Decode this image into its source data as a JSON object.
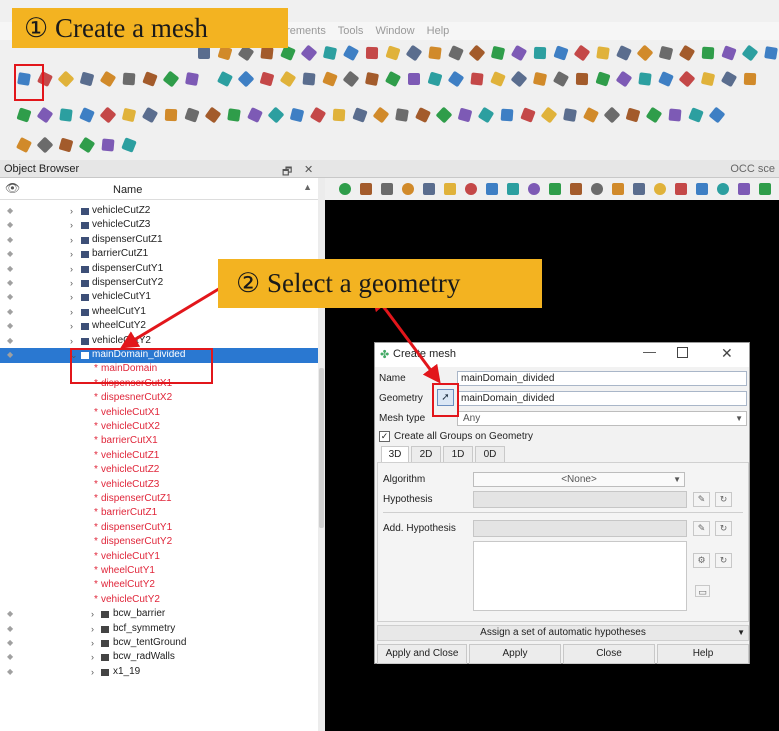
{
  "annotations": {
    "step1": "① Create a mesh",
    "step2": "② Select a geometry"
  },
  "menubar": {
    "items_visible": [
      "urements",
      "Tools",
      "Window",
      "Help"
    ]
  },
  "colors": {
    "banner": "#f3b321",
    "highlight_box": "#e2161b",
    "selection": "#2a78d1",
    "child_text": "#e0263a"
  },
  "object_browser": {
    "title": "Object Browser",
    "column_name": "Name",
    "items": [
      {
        "label": "vehicleCutZ2",
        "kind": "geom"
      },
      {
        "label": "vehicleCutZ3",
        "kind": "geom"
      },
      {
        "label": "dispenserCutZ1",
        "kind": "geom"
      },
      {
        "label": "barrierCutZ1",
        "kind": "geom"
      },
      {
        "label": "dispenserCutY1",
        "kind": "geom"
      },
      {
        "label": "dispenserCutY2",
        "kind": "geom"
      },
      {
        "label": "vehicleCutY1",
        "kind": "geom"
      },
      {
        "label": "wheelCutY1",
        "kind": "geom"
      },
      {
        "label": "wheelCutY2",
        "kind": "geom"
      },
      {
        "label": "vehicleCutY2",
        "kind": "geom"
      },
      {
        "label": "mainDomain_divided",
        "kind": "selected"
      },
      {
        "label": "mainDomain",
        "kind": "child"
      },
      {
        "label": "dispenserCutX1",
        "kind": "child"
      },
      {
        "label": "dispesnerCutX2",
        "kind": "child"
      },
      {
        "label": "vehicleCutX1",
        "kind": "child"
      },
      {
        "label": "vehicleCutX2",
        "kind": "child"
      },
      {
        "label": "barrierCutX1",
        "kind": "child"
      },
      {
        "label": "vehicleCutZ1",
        "kind": "child"
      },
      {
        "label": "vehicleCutZ2",
        "kind": "child"
      },
      {
        "label": "vehicleCutZ3",
        "kind": "child"
      },
      {
        "label": "dispenserCutZ1",
        "kind": "child"
      },
      {
        "label": "barrierCutZ1",
        "kind": "child"
      },
      {
        "label": "dispenserCutY1",
        "kind": "child"
      },
      {
        "label": "dispenserCutY2",
        "kind": "child"
      },
      {
        "label": "vehicleCutY1",
        "kind": "child"
      },
      {
        "label": "wheelCutY1",
        "kind": "child"
      },
      {
        "label": "wheelCutY2",
        "kind": "child"
      },
      {
        "label": "vehicleCutY2",
        "kind": "child"
      },
      {
        "label": "bcw_barrier",
        "kind": "group"
      },
      {
        "label": "bcf_symmetry",
        "kind": "group"
      },
      {
        "label": "bcw_tentGround",
        "kind": "group"
      },
      {
        "label": "bcw_radWalls",
        "kind": "group"
      },
      {
        "label": "x1_19",
        "kind": "group"
      }
    ]
  },
  "viewer": {
    "title": "OCC sce"
  },
  "dialog": {
    "title": "Create mesh",
    "name_label": "Name",
    "name_value": "mainDomain_divided",
    "geometry_label": "Geometry",
    "geometry_value": "mainDomain_divided",
    "mesh_type_label": "Mesh type",
    "mesh_type_value": "Any",
    "create_groups_label": "Create all Groups on Geometry",
    "tabs": [
      "3D",
      "2D",
      "1D",
      "0D"
    ],
    "algorithm_label": "Algorithm",
    "algorithm_value": "<None>",
    "hypothesis_label": "Hypothesis",
    "add_hypothesis_label": "Add. Hypothesis",
    "assign_label": "Assign a set of automatic hypotheses",
    "buttons": {
      "apply_close": "Apply and Close",
      "apply": "Apply",
      "close": "Close",
      "help": "Help"
    }
  }
}
